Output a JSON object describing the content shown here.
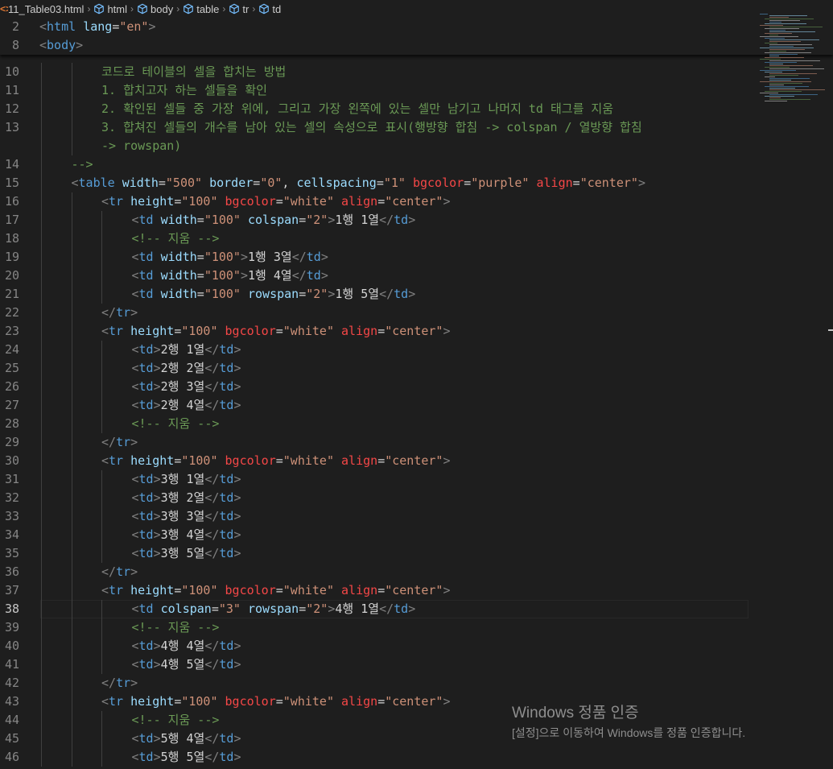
{
  "breadcrumb": {
    "file": "11_Table03.html",
    "items": [
      "html",
      "body",
      "table",
      "tr",
      "td"
    ]
  },
  "sticky": [
    {
      "n": "2",
      "tokens": [
        [
          "p",
          "<"
        ],
        [
          "t",
          "html"
        ],
        [
          "x",
          " "
        ],
        [
          "a",
          "lang"
        ],
        [
          "x",
          "="
        ],
        [
          "v",
          "\"en\""
        ],
        [
          "p",
          ">"
        ]
      ]
    },
    {
      "n": "8",
      "tokens": [
        [
          "p",
          "<"
        ],
        [
          "t",
          "body"
        ],
        [
          "p",
          ">"
        ]
      ]
    }
  ],
  "lines": [
    {
      "n": "10",
      "indent": 2,
      "tokens": [
        [
          "c",
          "코드로 테이블의 셀을 합치는 방법"
        ]
      ]
    },
    {
      "n": "11",
      "indent": 2,
      "tokens": [
        [
          "c",
          "1. 합치고자 하는 셀들을 확인"
        ]
      ]
    },
    {
      "n": "12",
      "indent": 2,
      "tokens": [
        [
          "c",
          "2. 확인된 셀들 중 가장 위에, 그리고 가장 왼쪽에 있는 셀만 남기고 나머지 td 태그를 지움"
        ]
      ]
    },
    {
      "n": "13",
      "indent": 2,
      "tokens": [
        [
          "c",
          "3. 합쳐진 셀들의 개수를 남아 있는 셀의 속성으로 표시(행방향 합침 -> colspan / 열방향 합침"
        ]
      ]
    },
    {
      "n": "",
      "indent": 2,
      "tokens": [
        [
          "c",
          "-> rowspan)"
        ]
      ]
    },
    {
      "n": "14",
      "indent": 1,
      "tokens": [
        [
          "c",
          "-->"
        ]
      ]
    },
    {
      "n": "15",
      "indent": 1,
      "tokens": [
        [
          "p",
          "<"
        ],
        [
          "t",
          "table"
        ],
        [
          "x",
          " "
        ],
        [
          "a",
          "width"
        ],
        [
          "x",
          "="
        ],
        [
          "v",
          "\"500\""
        ],
        [
          "x",
          " "
        ],
        [
          "a",
          "border"
        ],
        [
          "x",
          "="
        ],
        [
          "v",
          "\"0\""
        ],
        [
          "x",
          ", "
        ],
        [
          "a",
          "cellspacing"
        ],
        [
          "x",
          "="
        ],
        [
          "v",
          "\"1\""
        ],
        [
          "x",
          " "
        ],
        [
          "r",
          "bgcolor"
        ],
        [
          "x",
          "="
        ],
        [
          "v",
          "\"purple\""
        ],
        [
          "x",
          " "
        ],
        [
          "r",
          "align"
        ],
        [
          "x",
          "="
        ],
        [
          "v",
          "\"center\""
        ],
        [
          "p",
          ">"
        ]
      ]
    },
    {
      "n": "16",
      "indent": 2,
      "tokens": [
        [
          "p",
          "<"
        ],
        [
          "t",
          "tr"
        ],
        [
          "x",
          " "
        ],
        [
          "a",
          "height"
        ],
        [
          "x",
          "="
        ],
        [
          "v",
          "\"100\""
        ],
        [
          "x",
          " "
        ],
        [
          "r",
          "bgcolor"
        ],
        [
          "x",
          "="
        ],
        [
          "v",
          "\"white\""
        ],
        [
          "x",
          " "
        ],
        [
          "r",
          "align"
        ],
        [
          "x",
          "="
        ],
        [
          "v",
          "\"center\""
        ],
        [
          "p",
          ">"
        ]
      ]
    },
    {
      "n": "17",
      "indent": 3,
      "tokens": [
        [
          "p",
          "<"
        ],
        [
          "t",
          "td"
        ],
        [
          "x",
          " "
        ],
        [
          "a",
          "width"
        ],
        [
          "x",
          "="
        ],
        [
          "v",
          "\"100\""
        ],
        [
          "x",
          " "
        ],
        [
          "a",
          "colspan"
        ],
        [
          "x",
          "="
        ],
        [
          "v",
          "\"2\""
        ],
        [
          "p",
          ">"
        ],
        [
          "x",
          "1행 1열"
        ],
        [
          "p",
          "</"
        ],
        [
          "t",
          "td"
        ],
        [
          "p",
          ">"
        ]
      ]
    },
    {
      "n": "18",
      "indent": 3,
      "tokens": [
        [
          "c",
          "<!-- 지움 -->"
        ]
      ]
    },
    {
      "n": "19",
      "indent": 3,
      "tokens": [
        [
          "p",
          "<"
        ],
        [
          "t",
          "td"
        ],
        [
          "x",
          " "
        ],
        [
          "a",
          "width"
        ],
        [
          "x",
          "="
        ],
        [
          "v",
          "\"100\""
        ],
        [
          "p",
          ">"
        ],
        [
          "x",
          "1행 3열"
        ],
        [
          "p",
          "</"
        ],
        [
          "t",
          "td"
        ],
        [
          "p",
          ">"
        ]
      ]
    },
    {
      "n": "20",
      "indent": 3,
      "tokens": [
        [
          "p",
          "<"
        ],
        [
          "t",
          "td"
        ],
        [
          "x",
          " "
        ],
        [
          "a",
          "width"
        ],
        [
          "x",
          "="
        ],
        [
          "v",
          "\"100\""
        ],
        [
          "p",
          ">"
        ],
        [
          "x",
          "1행 4열"
        ],
        [
          "p",
          "</"
        ],
        [
          "t",
          "td"
        ],
        [
          "p",
          ">"
        ]
      ]
    },
    {
      "n": "21",
      "indent": 3,
      "tokens": [
        [
          "p",
          "<"
        ],
        [
          "t",
          "td"
        ],
        [
          "x",
          " "
        ],
        [
          "a",
          "width"
        ],
        [
          "x",
          "="
        ],
        [
          "v",
          "\"100\""
        ],
        [
          "x",
          " "
        ],
        [
          "a",
          "rowspan"
        ],
        [
          "x",
          "="
        ],
        [
          "v",
          "\"2\""
        ],
        [
          "p",
          ">"
        ],
        [
          "x",
          "1행 5열"
        ],
        [
          "p",
          "</"
        ],
        [
          "t",
          "td"
        ],
        [
          "p",
          ">"
        ]
      ]
    },
    {
      "n": "22",
      "indent": 2,
      "tokens": [
        [
          "p",
          "</"
        ],
        [
          "t",
          "tr"
        ],
        [
          "p",
          ">"
        ]
      ]
    },
    {
      "n": "23",
      "indent": 2,
      "tokens": [
        [
          "p",
          "<"
        ],
        [
          "t",
          "tr"
        ],
        [
          "x",
          " "
        ],
        [
          "a",
          "height"
        ],
        [
          "x",
          "="
        ],
        [
          "v",
          "\"100\""
        ],
        [
          "x",
          " "
        ],
        [
          "r",
          "bgcolor"
        ],
        [
          "x",
          "="
        ],
        [
          "v",
          "\"white\""
        ],
        [
          "x",
          " "
        ],
        [
          "r",
          "align"
        ],
        [
          "x",
          "="
        ],
        [
          "v",
          "\"center\""
        ],
        [
          "p",
          ">"
        ]
      ]
    },
    {
      "n": "24",
      "indent": 3,
      "tokens": [
        [
          "p",
          "<"
        ],
        [
          "t",
          "td"
        ],
        [
          "p",
          ">"
        ],
        [
          "x",
          "2행 1열"
        ],
        [
          "p",
          "</"
        ],
        [
          "t",
          "td"
        ],
        [
          "p",
          ">"
        ]
      ]
    },
    {
      "n": "25",
      "indent": 3,
      "tokens": [
        [
          "p",
          "<"
        ],
        [
          "t",
          "td"
        ],
        [
          "p",
          ">"
        ],
        [
          "x",
          "2행 2열"
        ],
        [
          "p",
          "</"
        ],
        [
          "t",
          "td"
        ],
        [
          "p",
          ">"
        ]
      ]
    },
    {
      "n": "26",
      "indent": 3,
      "tokens": [
        [
          "p",
          "<"
        ],
        [
          "t",
          "td"
        ],
        [
          "p",
          ">"
        ],
        [
          "x",
          "2행 3열"
        ],
        [
          "p",
          "</"
        ],
        [
          "t",
          "td"
        ],
        [
          "p",
          ">"
        ]
      ]
    },
    {
      "n": "27",
      "indent": 3,
      "tokens": [
        [
          "p",
          "<"
        ],
        [
          "t",
          "td"
        ],
        [
          "p",
          ">"
        ],
        [
          "x",
          "2행 4열"
        ],
        [
          "p",
          "</"
        ],
        [
          "t",
          "td"
        ],
        [
          "p",
          ">"
        ]
      ]
    },
    {
      "n": "28",
      "indent": 3,
      "tokens": [
        [
          "c",
          "<!-- 지움 -->"
        ]
      ]
    },
    {
      "n": "29",
      "indent": 2,
      "tokens": [
        [
          "p",
          "</"
        ],
        [
          "t",
          "tr"
        ],
        [
          "p",
          ">"
        ]
      ]
    },
    {
      "n": "30",
      "indent": 2,
      "tokens": [
        [
          "p",
          "<"
        ],
        [
          "t",
          "tr"
        ],
        [
          "x",
          " "
        ],
        [
          "a",
          "height"
        ],
        [
          "x",
          "="
        ],
        [
          "v",
          "\"100\""
        ],
        [
          "x",
          " "
        ],
        [
          "r",
          "bgcolor"
        ],
        [
          "x",
          "="
        ],
        [
          "v",
          "\"white\""
        ],
        [
          "x",
          " "
        ],
        [
          "r",
          "align"
        ],
        [
          "x",
          "="
        ],
        [
          "v",
          "\"center\""
        ],
        [
          "p",
          ">"
        ]
      ]
    },
    {
      "n": "31",
      "indent": 3,
      "tokens": [
        [
          "p",
          "<"
        ],
        [
          "t",
          "td"
        ],
        [
          "p",
          ">"
        ],
        [
          "x",
          "3행 1열"
        ],
        [
          "p",
          "</"
        ],
        [
          "t",
          "td"
        ],
        [
          "p",
          ">"
        ]
      ]
    },
    {
      "n": "32",
      "indent": 3,
      "tokens": [
        [
          "p",
          "<"
        ],
        [
          "t",
          "td"
        ],
        [
          "p",
          ">"
        ],
        [
          "x",
          "3행 2열"
        ],
        [
          "p",
          "</"
        ],
        [
          "t",
          "td"
        ],
        [
          "p",
          ">"
        ]
      ]
    },
    {
      "n": "33",
      "indent": 3,
      "tokens": [
        [
          "p",
          "<"
        ],
        [
          "t",
          "td"
        ],
        [
          "p",
          ">"
        ],
        [
          "x",
          "3행 3열"
        ],
        [
          "p",
          "</"
        ],
        [
          "t",
          "td"
        ],
        [
          "p",
          ">"
        ]
      ]
    },
    {
      "n": "34",
      "indent": 3,
      "tokens": [
        [
          "p",
          "<"
        ],
        [
          "t",
          "td"
        ],
        [
          "p",
          ">"
        ],
        [
          "x",
          "3행 4열"
        ],
        [
          "p",
          "</"
        ],
        [
          "t",
          "td"
        ],
        [
          "p",
          ">"
        ]
      ]
    },
    {
      "n": "35",
      "indent": 3,
      "tokens": [
        [
          "p",
          "<"
        ],
        [
          "t",
          "td"
        ],
        [
          "p",
          ">"
        ],
        [
          "x",
          "3행 5열"
        ],
        [
          "p",
          "</"
        ],
        [
          "t",
          "td"
        ],
        [
          "p",
          ">"
        ]
      ]
    },
    {
      "n": "36",
      "indent": 2,
      "tokens": [
        [
          "p",
          "</"
        ],
        [
          "t",
          "tr"
        ],
        [
          "p",
          ">"
        ]
      ]
    },
    {
      "n": "37",
      "indent": 2,
      "tokens": [
        [
          "p",
          "<"
        ],
        [
          "t",
          "tr"
        ],
        [
          "x",
          " "
        ],
        [
          "a",
          "height"
        ],
        [
          "x",
          "="
        ],
        [
          "v",
          "\"100\""
        ],
        [
          "x",
          " "
        ],
        [
          "r",
          "bgcolor"
        ],
        [
          "x",
          "="
        ],
        [
          "v",
          "\"white\""
        ],
        [
          "x",
          " "
        ],
        [
          "r",
          "align"
        ],
        [
          "x",
          "="
        ],
        [
          "v",
          "\"center\""
        ],
        [
          "p",
          ">"
        ]
      ]
    },
    {
      "n": "38",
      "indent": 3,
      "active": true,
      "tokens": [
        [
          "p",
          "<"
        ],
        [
          "t",
          "td"
        ],
        [
          "x",
          " "
        ],
        [
          "a",
          "colspan"
        ],
        [
          "x",
          "="
        ],
        [
          "v",
          "\"3\""
        ],
        [
          "x",
          " "
        ],
        [
          "a",
          "rowspan"
        ],
        [
          "x",
          "="
        ],
        [
          "v",
          "\"2\""
        ],
        [
          "p",
          ">"
        ],
        [
          "x",
          "4행 1열"
        ],
        [
          "p",
          "</"
        ],
        [
          "t",
          "td"
        ],
        [
          "p",
          ">"
        ]
      ]
    },
    {
      "n": "39",
      "indent": 3,
      "tokens": [
        [
          "c",
          "<!-- 지움 -->"
        ]
      ]
    },
    {
      "n": "40",
      "indent": 3,
      "tokens": [
        [
          "p",
          "<"
        ],
        [
          "t",
          "td"
        ],
        [
          "p",
          ">"
        ],
        [
          "x",
          "4행 4열"
        ],
        [
          "p",
          "</"
        ],
        [
          "t",
          "td"
        ],
        [
          "p",
          ">"
        ]
      ]
    },
    {
      "n": "41",
      "indent": 3,
      "tokens": [
        [
          "p",
          "<"
        ],
        [
          "t",
          "td"
        ],
        [
          "p",
          ">"
        ],
        [
          "x",
          "4행 5열"
        ],
        [
          "p",
          "</"
        ],
        [
          "t",
          "td"
        ],
        [
          "p",
          ">"
        ]
      ]
    },
    {
      "n": "42",
      "indent": 2,
      "tokens": [
        [
          "p",
          "</"
        ],
        [
          "t",
          "tr"
        ],
        [
          "p",
          ">"
        ]
      ]
    },
    {
      "n": "43",
      "indent": 2,
      "tokens": [
        [
          "p",
          "<"
        ],
        [
          "t",
          "tr"
        ],
        [
          "x",
          " "
        ],
        [
          "a",
          "height"
        ],
        [
          "x",
          "="
        ],
        [
          "v",
          "\"100\""
        ],
        [
          "x",
          " "
        ],
        [
          "r",
          "bgcolor"
        ],
        [
          "x",
          "="
        ],
        [
          "v",
          "\"white\""
        ],
        [
          "x",
          " "
        ],
        [
          "r",
          "align"
        ],
        [
          "x",
          "="
        ],
        [
          "v",
          "\"center\""
        ],
        [
          "p",
          ">"
        ]
      ]
    },
    {
      "n": "44",
      "indent": 3,
      "tokens": [
        [
          "c",
          "<!-- 지움 -->"
        ]
      ]
    },
    {
      "n": "45",
      "indent": 3,
      "tokens": [
        [
          "p",
          "<"
        ],
        [
          "t",
          "td"
        ],
        [
          "p",
          ">"
        ],
        [
          "x",
          "5행 4열"
        ],
        [
          "p",
          "</"
        ],
        [
          "t",
          "td"
        ],
        [
          "p",
          ">"
        ]
      ]
    },
    {
      "n": "46",
      "indent": 3,
      "tokens": [
        [
          "p",
          "<"
        ],
        [
          "t",
          "td"
        ],
        [
          "p",
          ">"
        ],
        [
          "x",
          "5행 5열"
        ],
        [
          "p",
          "</"
        ],
        [
          "t",
          "td"
        ],
        [
          "p",
          ">"
        ]
      ]
    }
  ],
  "watermark": {
    "title": "Windows 정품 인증",
    "subtitle": "[설정]으로 이동하여 Windows를 정품 인증합니다."
  },
  "colors": {
    "background": "#1e1e1e",
    "tag": "#569cd6",
    "attribute": "#9cdcfe",
    "string": "#ce9178",
    "comment": "#6a9955",
    "deprecated_attribute": "#f44747",
    "punctuation": "#808080",
    "text": "#d4d4d4",
    "line_number": "#858585"
  }
}
